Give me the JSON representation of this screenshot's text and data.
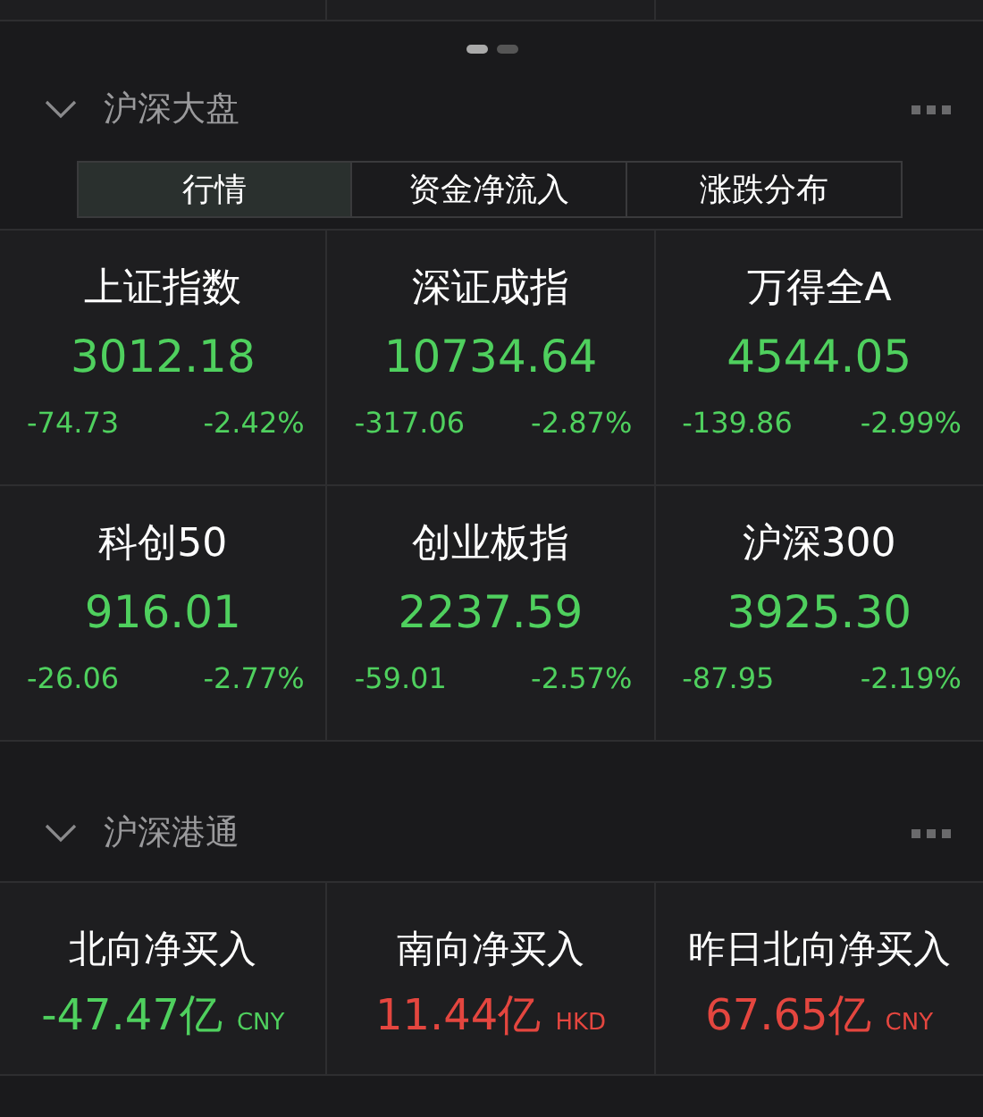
{
  "pager": [
    {
      "selected": true
    },
    {
      "selected": false
    }
  ],
  "market": {
    "title": "沪深大盘",
    "expanded": true,
    "tabs": [
      {
        "label": "行情",
        "selected": true
      },
      {
        "label": "资金净流入",
        "selected": false
      },
      {
        "label": "涨跌分布",
        "selected": false
      }
    ],
    "indices": [
      {
        "name": "上证指数",
        "value": "3012.18",
        "change": "-74.73",
        "percent": "-2.42%",
        "color": "#4fd05e"
      },
      {
        "name": "深证成指",
        "value": "10734.64",
        "change": "-317.06",
        "percent": "-2.87%",
        "color": "#4fd05e"
      },
      {
        "name": "万得全A",
        "value": "4544.05",
        "change": "-139.86",
        "percent": "-2.99%",
        "color": "#4fd05e"
      },
      {
        "name": "科创50",
        "value": "916.01",
        "change": "-26.06",
        "percent": "-2.77%",
        "color": "#4fd05e"
      },
      {
        "name": "创业板指",
        "value": "2237.59",
        "change": "-59.01",
        "percent": "-2.57%",
        "color": "#4fd05e"
      },
      {
        "name": "沪深300",
        "value": "3925.30",
        "change": "-87.95",
        "percent": "-2.19%",
        "color": "#4fd05e"
      }
    ]
  },
  "connect": {
    "title": "沪深港通",
    "expanded": true,
    "flows": [
      {
        "name": "北向净买入",
        "value": "-47.47亿",
        "currency": "CNY",
        "color": "#4fd05e"
      },
      {
        "name": "南向净买入",
        "value": "11.44亿",
        "currency": "HKD",
        "color": "#e4463f"
      },
      {
        "name": "昨日北向净买入",
        "value": "67.65亿",
        "currency": "CNY",
        "color": "#e4463f"
      }
    ]
  }
}
